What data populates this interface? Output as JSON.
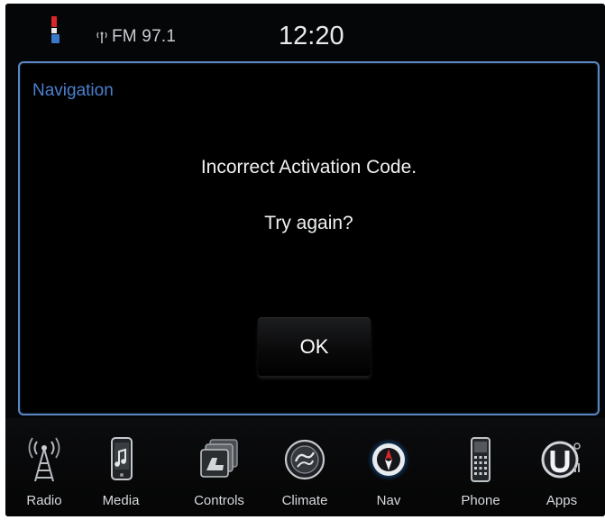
{
  "status_bar": {
    "radio_station": "FM 97.1",
    "clock": "12:20",
    "icons": [
      "flag-icon",
      "antenna-icon"
    ]
  },
  "dialog": {
    "title": "Navigation",
    "message_line1": "Incorrect Activation Code.",
    "message_line2": "Try again?",
    "ok_label": "OK"
  },
  "dock": {
    "items": [
      {
        "label": "Radio",
        "icon": "radio-tower-icon"
      },
      {
        "label": "Media",
        "icon": "media-device-icon"
      },
      {
        "label": "Controls",
        "icon": "controls-icon"
      },
      {
        "label": "Climate",
        "icon": "climate-icon"
      },
      {
        "label": "Nav",
        "icon": "nav-compass-icon"
      },
      {
        "label": "Phone",
        "icon": "phone-icon"
      },
      {
        "label": "Apps",
        "icon": "apps-icon"
      }
    ],
    "active": "Nav"
  },
  "colors": {
    "panel_border": "#5c86c0",
    "title_blue": "#4d7fcf",
    "background": "#050608",
    "nav_glow": "#3fb1ff"
  }
}
